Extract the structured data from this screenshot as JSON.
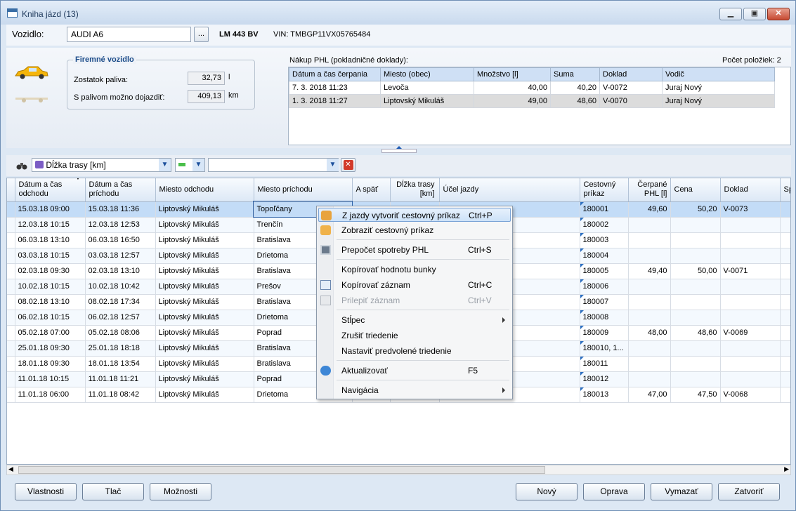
{
  "window": {
    "title": "Kniha jázd (13)"
  },
  "vehicle": {
    "label": "Vozidlo:",
    "name": "AUDI A6",
    "browse": "...",
    "plate": "LM 443 BV",
    "vin": "VIN: TMBGP11VX05765484"
  },
  "fuel_group": {
    "title": "Firemné vozidlo",
    "remaining_label": "Zostatok paliva:",
    "remaining_value": "32,73",
    "remaining_unit": "l",
    "range_label": "S palivom možno dojazdiť:",
    "range_value": "409,13",
    "range_unit": "km"
  },
  "purchases": {
    "title": "Nákup PHL (pokladničné doklady):",
    "count_label": "Počet položiek: 2",
    "columns": [
      "Dátum a čas čerpania",
      "Miesto (obec)",
      "Množstvo [l]",
      "Suma",
      "Doklad",
      "Vodič"
    ],
    "rows": [
      [
        "7. 3. 2018 11:23",
        "Levoča",
        "40,00",
        "40,20",
        "V-0072",
        "Juraj Nový"
      ],
      [
        "1. 3. 2018 11:27",
        "Liptovský Mikuláš",
        "49,00",
        "48,60",
        "V-0070",
        "Juraj Nový"
      ]
    ]
  },
  "filter": {
    "field": "Dĺžka trasy  [km]",
    "value": ""
  },
  "grid": {
    "columns": [
      "Dátum a čas odchodu",
      "Dátum a čas príchodu",
      "Miesto odchodu",
      "Miesto príchodu",
      "A späť",
      "Dĺžka trasy [km]",
      "Účel jazdy",
      "Cestovný príkaz",
      "Čerpané PHL [l]",
      "Cena",
      "Doklad",
      "Sp"
    ],
    "rows": [
      [
        "15.03.18 09:00",
        "15.03.18 11:36",
        "Liptovský Mikuláš",
        "Topoľčany",
        "",
        "",
        "",
        "180001",
        "49,60",
        "50,20",
        "V-0073"
      ],
      [
        "12.03.18 10:15",
        "12.03.18 12:53",
        "Liptovský Mikuláš",
        "Trenčín",
        "",
        "",
        "ochodu",
        "180002",
        "",
        "",
        ""
      ],
      [
        "06.03.18 13:10",
        "06.03.18 16:50",
        "Liptovský Mikuláš",
        "Bratislava",
        "",
        "",
        "",
        "180003",
        "",
        "",
        ""
      ],
      [
        "03.03.18 10:15",
        "03.03.18 12:57",
        "Liptovský Mikuláš",
        "Drietoma",
        "",
        "",
        "ochodu",
        "180004",
        "",
        "",
        ""
      ],
      [
        "02.03.18 09:30",
        "02.03.18 13:10",
        "Liptovský Mikuláš",
        "Bratislava",
        "",
        "",
        "",
        "180005",
        "49,40",
        "50,00",
        "V-0071"
      ],
      [
        "10.02.18 10:15",
        "10.02.18 10:42",
        "Liptovský Mikuláš",
        "Prešov",
        "",
        "",
        "ochodu",
        "180006",
        "",
        "",
        ""
      ],
      [
        "08.02.18 13:10",
        "08.02.18 17:34",
        "Liptovský Mikuláš",
        "Bratislava",
        "",
        "",
        "",
        "180007",
        "",
        "",
        ""
      ],
      [
        "06.02.18 10:15",
        "06.02.18 12:57",
        "Liptovský Mikuláš",
        "Drietoma",
        "",
        "",
        "",
        "180008",
        "",
        "",
        ""
      ],
      [
        "05.02.18 07:00",
        "05.02.18 08:06",
        "Liptovský Mikuláš",
        "Poprad",
        "",
        "",
        "ochodu",
        "180009",
        "48,00",
        "48,60",
        "V-0069"
      ],
      [
        "25.01.18 09:30",
        "25.01.18 18:18",
        "Liptovský Mikuláš",
        "Bratislava",
        "",
        "",
        "",
        "180010, 1...",
        "",
        "",
        ""
      ],
      [
        "18.01.18 09:30",
        "18.01.18 13:54",
        "Liptovský Mikuláš",
        "Bratislava",
        "",
        "",
        "",
        "180011",
        "",
        "",
        ""
      ],
      [
        "11.01.18 10:15",
        "11.01.18 11:21",
        "Liptovský Mikuláš",
        "Poprad",
        "",
        "",
        "ochodu",
        "180012",
        "",
        "",
        ""
      ],
      [
        "11.01.18 06:00",
        "11.01.18 08:42",
        "Liptovský Mikuláš",
        "Drietoma",
        "",
        "",
        "ochodu",
        "180013",
        "47,00",
        "47,50",
        "V-0068"
      ]
    ]
  },
  "context_menu": {
    "create_order": "Z jazdy vytvoriť cestovný príkaz",
    "create_order_sc": "Ctrl+P",
    "show_order": "Zobraziť cestovný príkaz",
    "recalc": "Prepočet spotreby PHL",
    "recalc_sc": "Ctrl+S",
    "copy_cell": "Kopírovať hodnotu bunky",
    "copy_record": "Kopírovať záznam",
    "copy_record_sc": "Ctrl+C",
    "paste_record": "Prilepiť záznam",
    "paste_record_sc": "Ctrl+V",
    "column": "Stĺpec",
    "cancel_sort": "Zrušiť triedenie",
    "default_sort": "Nastaviť predvolené triedenie",
    "refresh": "Aktualizovať",
    "refresh_sc": "F5",
    "navigation": "Navigácia"
  },
  "buttons": {
    "properties": "Vlastnosti",
    "print": "Tlač",
    "options": "Možnosti",
    "new": "Nový",
    "edit": "Oprava",
    "delete": "Vymazať",
    "close": "Zatvoriť"
  }
}
